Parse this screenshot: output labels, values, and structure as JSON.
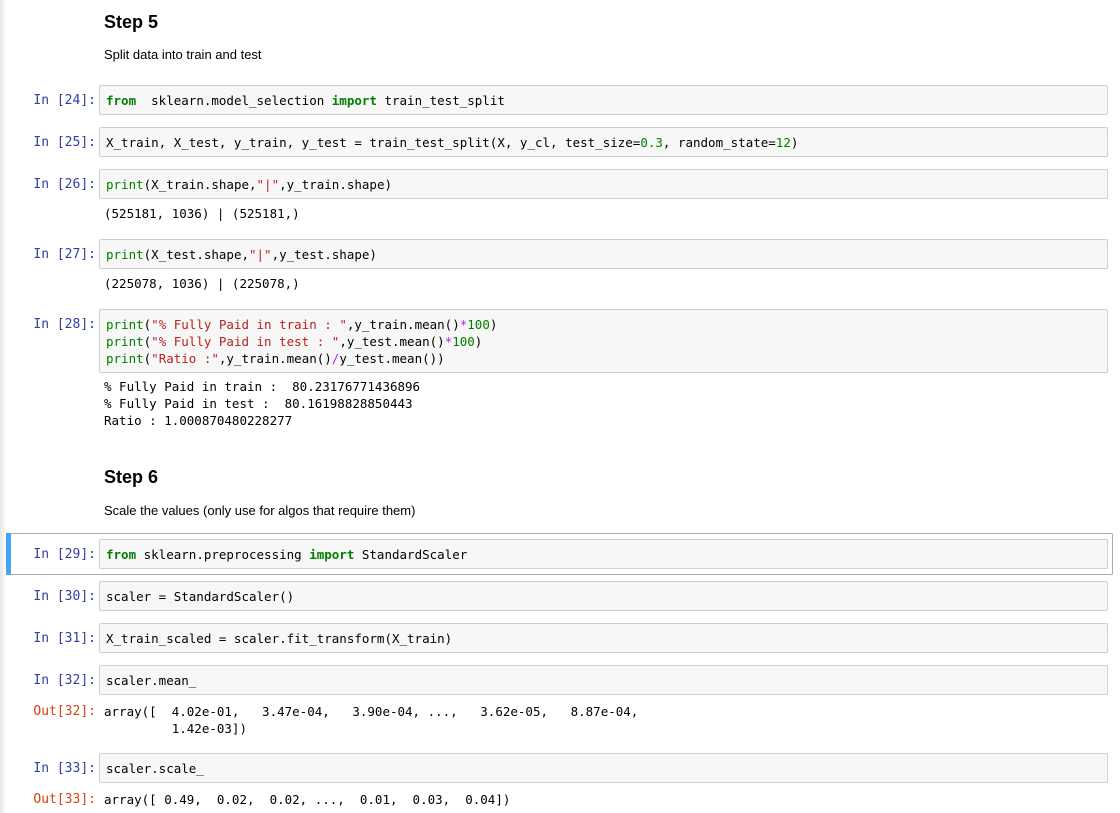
{
  "step5": {
    "heading": "Step 5",
    "description": "Split data into train and test"
  },
  "step6": {
    "heading": "Step 6",
    "description": "Scale the values (only use for algos that require them)"
  },
  "cells": {
    "c24": {
      "prompt": "In [24]:",
      "code": [
        [
          "kw",
          "from"
        ],
        [
          "",
          "  sklearn.model_selection "
        ],
        [
          "kw",
          "import"
        ],
        [
          "",
          " train_test_split"
        ]
      ]
    },
    "c25": {
      "prompt": "In [25]:",
      "code": [
        [
          "",
          "X_train, X_test, y_train, y_test = train_test_split(X, y_cl, test_size="
        ],
        [
          "nm",
          "0.3"
        ],
        [
          "",
          ", random_state="
        ],
        [
          "nm",
          "12"
        ],
        [
          "",
          ")"
        ]
      ]
    },
    "c26": {
      "prompt": "In [26]:",
      "code": [
        [
          "fn",
          "print"
        ],
        [
          "",
          "(X_train.shape,"
        ],
        [
          "st",
          "\"|\""
        ],
        [
          "",
          ",y_train.shape)"
        ]
      ],
      "output": "(525181, 1036) | (525181,)"
    },
    "c27": {
      "prompt": "In [27]:",
      "code": [
        [
          "fn",
          "print"
        ],
        [
          "",
          "(X_test.shape,"
        ],
        [
          "st",
          "\"|\""
        ],
        [
          "",
          ",y_test.shape)"
        ]
      ],
      "output": "(225078, 1036) | (225078,)"
    },
    "c28": {
      "prompt": "In [28]:",
      "code_lines": [
        [
          [
            "fn",
            "print"
          ],
          [
            "",
            "("
          ],
          [
            "st",
            "\"% Fully Paid in train : \""
          ],
          [
            "",
            ",y_train.mean()"
          ],
          [
            "op",
            "*"
          ],
          [
            "nm",
            "100"
          ],
          [
            "",
            ")"
          ]
        ],
        [
          [
            "fn",
            "print"
          ],
          [
            "",
            "("
          ],
          [
            "st",
            "\"% Fully Paid in test : \""
          ],
          [
            "",
            ",y_test.mean()"
          ],
          [
            "op",
            "*"
          ],
          [
            "nm",
            "100"
          ],
          [
            "",
            ")"
          ]
        ],
        [
          [
            "fn",
            "print"
          ],
          [
            "",
            "("
          ],
          [
            "st",
            "\"Ratio :\""
          ],
          [
            "",
            ",y_train.mean()"
          ],
          [
            "op",
            "/"
          ],
          [
            "",
            "y_test.mean())"
          ]
        ]
      ],
      "output": "% Fully Paid in train :  80.23176771436896\n% Fully Paid in test :  80.16198828850443\nRatio : 1.000870480228277"
    },
    "c29": {
      "prompt": "In [29]:",
      "code": [
        [
          "kw",
          "from"
        ],
        [
          "",
          " sklearn.preprocessing "
        ],
        [
          "kw",
          "import"
        ],
        [
          "",
          " StandardScaler"
        ]
      ]
    },
    "c30": {
      "prompt": "In [30]:",
      "code": [
        [
          "",
          "scaler = StandardScaler()"
        ]
      ]
    },
    "c31": {
      "prompt": "In [31]:",
      "code": [
        [
          "",
          "X_train_scaled = scaler.fit_transform(X_train)"
        ]
      ]
    },
    "c32": {
      "prompt": "In [32]:",
      "code": [
        [
          "",
          "scaler.mean_"
        ]
      ],
      "out_prompt": "Out[32]:",
      "output": "array([  4.02e-01,   3.47e-04,   3.90e-04, ...,   3.62e-05,   8.87e-04,\n         1.42e-03])"
    },
    "c33": {
      "prompt": "In [33]:",
      "code": [
        [
          "",
          "scaler.scale_"
        ]
      ],
      "out_prompt": "Out[33]:",
      "output": "array([ 0.49,  0.02,  0.02, ...,  0.01,  0.03,  0.04])"
    }
  }
}
